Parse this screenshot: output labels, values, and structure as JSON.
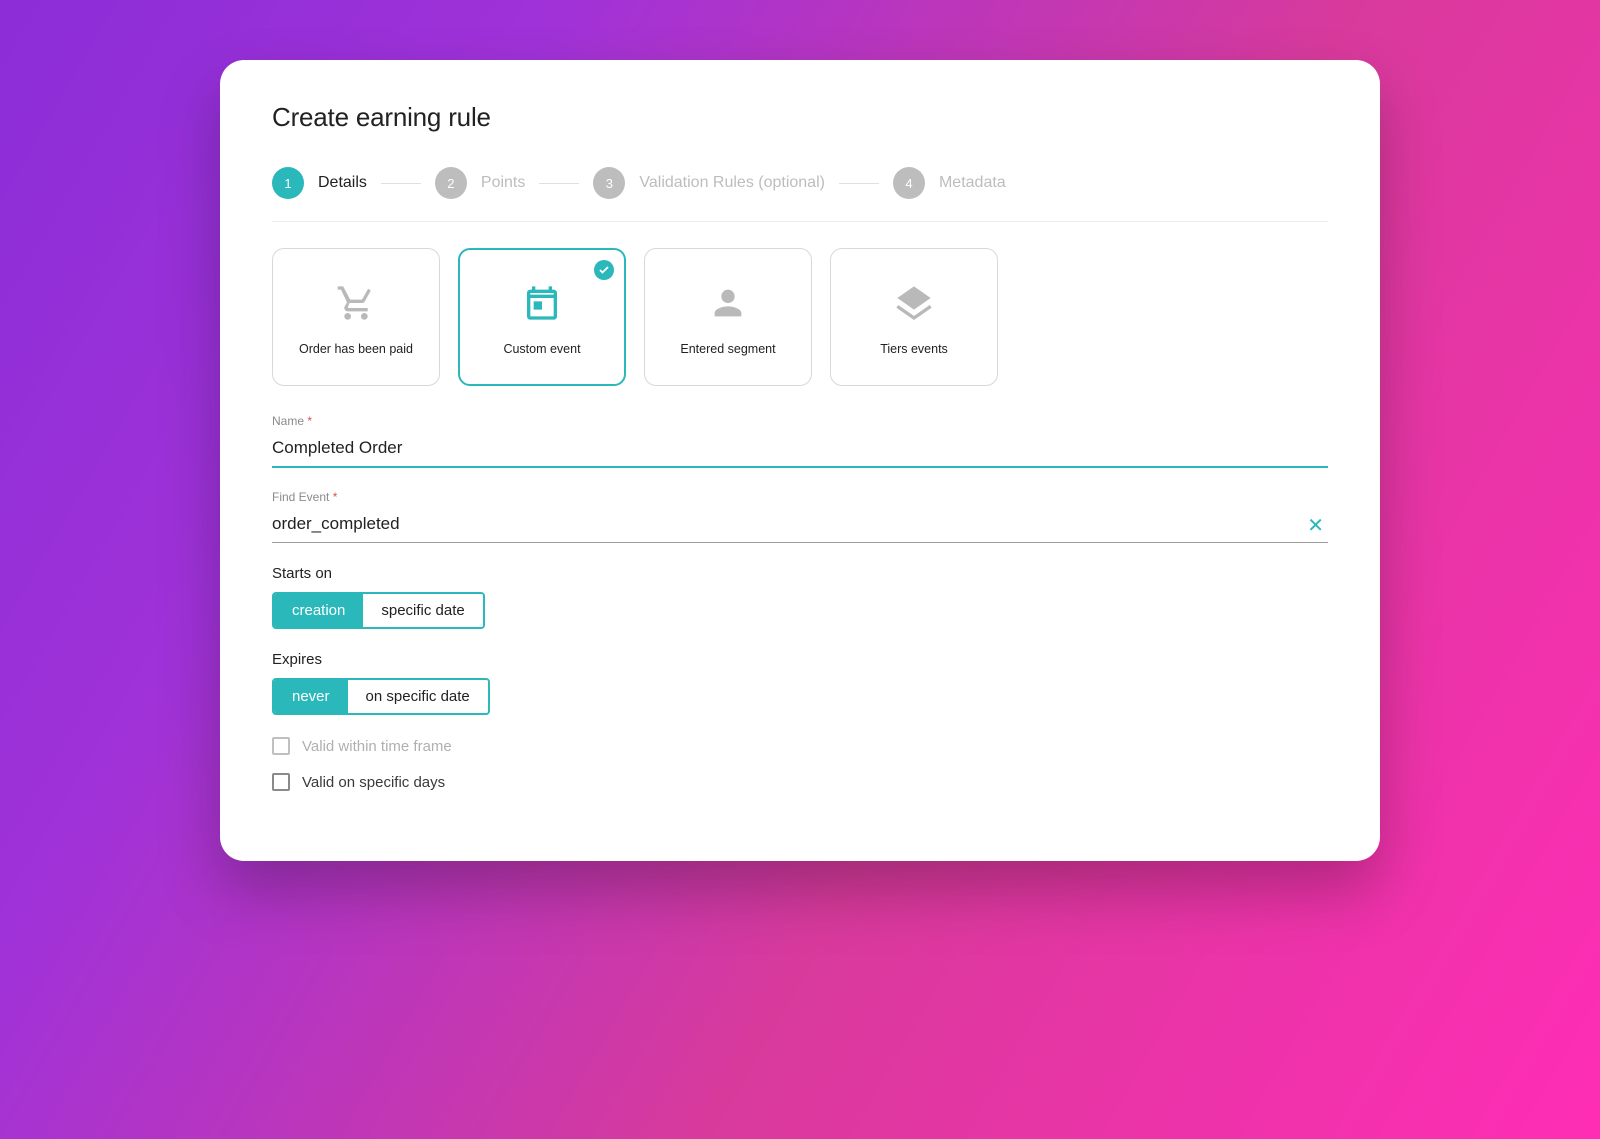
{
  "header": {
    "title": "Create earning rule"
  },
  "stepper": [
    {
      "num": "1",
      "label": "Details",
      "active": true
    },
    {
      "num": "2",
      "label": "Points",
      "active": false
    },
    {
      "num": "3",
      "label": "Validation Rules (optional)",
      "active": false
    },
    {
      "num": "4",
      "label": "Metadata",
      "active": false
    }
  ],
  "event_types": {
    "order_paid": "Order has been paid",
    "custom_event": "Custom event",
    "entered_segment": "Entered segment",
    "tiers_events": "Tiers events"
  },
  "fields": {
    "name_label": "Name",
    "name_value": "Completed Order",
    "find_event_label": "Find Event",
    "find_event_value": "order_completed",
    "required_marker": "*"
  },
  "starts_on": {
    "label": "Starts on",
    "options": {
      "creation": "creation",
      "specific": "specific date"
    }
  },
  "expires": {
    "label": "Expires",
    "options": {
      "never": "never",
      "specific": "on specific date"
    }
  },
  "checks": {
    "timeframe": "Valid within time frame",
    "specific_days": "Valid on specific days"
  }
}
